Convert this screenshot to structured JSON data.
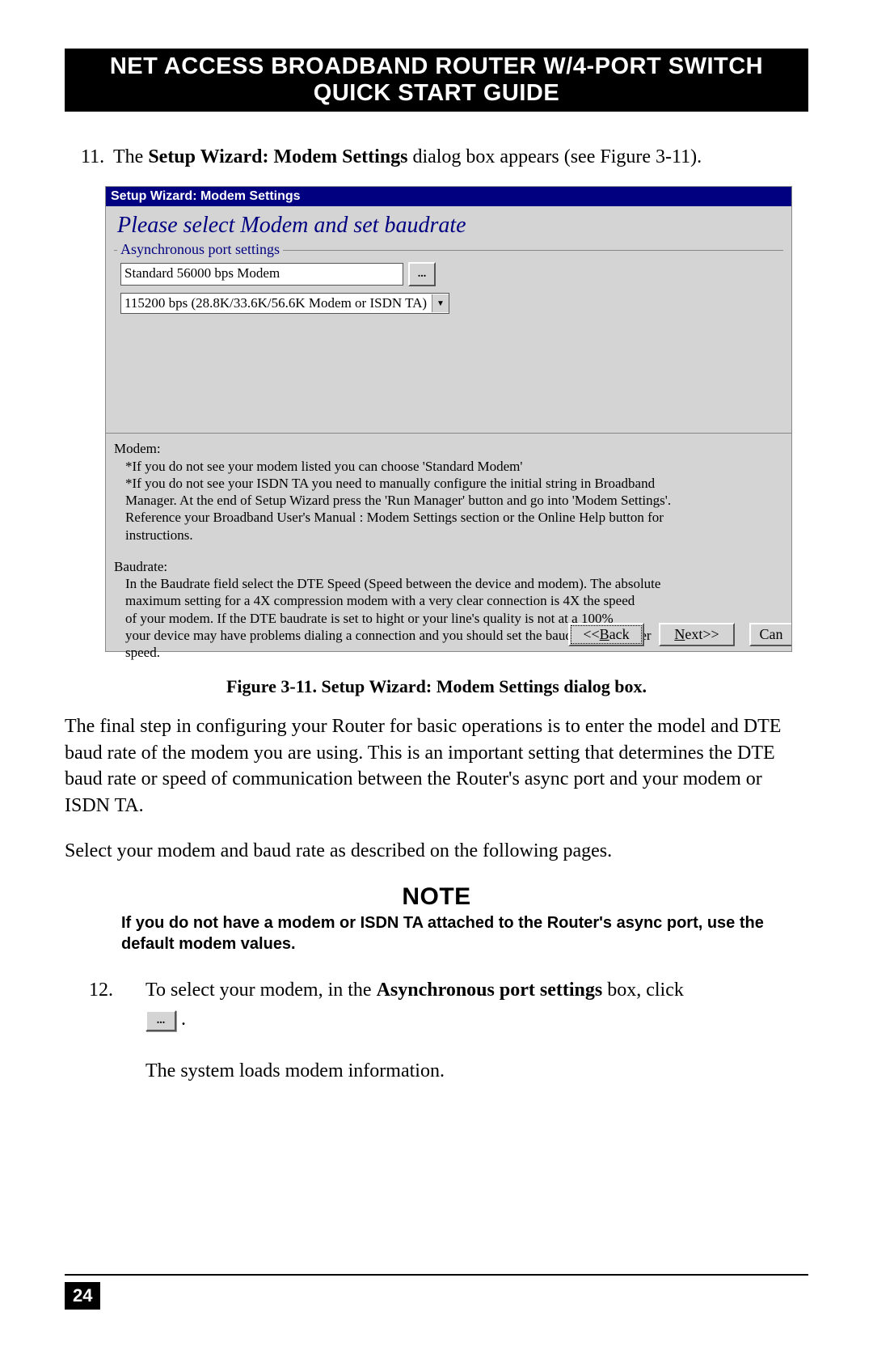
{
  "banner": "NET ACCESS BROADBAND ROUTER W/4-PORT SWITCH QUICK START GUIDE",
  "step11": {
    "num": "11.",
    "pre": "The ",
    "bold": "Setup Wizard: Modem Settings",
    "post": " dialog box appears (see Figure 3-11)."
  },
  "dialog": {
    "title": "Setup Wizard: Modem Settings",
    "heading": "Please select Modem and set baudrate",
    "fieldset_legend": "Asynchronous port settings",
    "modem_input": "Standard 56000 bps Modem",
    "ellipsis": "...",
    "baud_select": "115200 bps (28.8K/33.6K/56.6K Modem or ISDN TA)",
    "info": {
      "modem_label": "Modem:",
      "modem_line1": "*If you do not see your modem listed you can choose 'Standard Modem'",
      "modem_line2": "*If you do not see your ISDN TA you need to manually configure the initial string in Broadband",
      "modem_line3": "Manager.  At the end of Setup Wizard press the 'Run Manager' button and go into 'Modem Settings'.",
      "modem_line4": "Reference your Broadband User's Manual : Modem Settings section or the Online Help button for",
      "modem_line5": "instructions.",
      "baud_label": "Baudrate:",
      "baud_line1": "In the Baudrate field select the DTE Speed (Speed between the device and modem).  The absolute",
      "baud_line2": "maximum setting for a 4X compression modem with a very clear connection is 4X the speed",
      "baud_line3": "of your modem. If the DTE baudrate is set to hight or your line's quality is not at a 100%",
      "baud_line4": "your device may have problems dialing a connection and you should set the baudrate to a lower",
      "baud_line5": "speed."
    },
    "buttons": {
      "back": "<<Back",
      "next": "Next>>",
      "cancel": "Can"
    }
  },
  "caption": "Figure 3-11. Setup Wizard: Modem Settings dialog box.",
  "para1": "The final step in configuring your Router for basic operations is to enter the model and DTE baud rate of the modem you are using. This is an important setting that determines the DTE baud rate or speed of communication between the Router's async port and your modem or ISDN TA.",
  "para2": "Select your modem and baud rate as described on the following pages.",
  "note_head": "NOTE",
  "note_body": "If you do not have a modem or ISDN TA attached to the Router's async port, use the default modem values.",
  "step12": {
    "num": "12.",
    "t1": "To select your modem, in the ",
    "bold": "Asynchronous port settings",
    "t2": " box, click",
    "ellipsis": "...",
    "period": " ."
  },
  "post12": "The system loads modem information.",
  "page_number": "24"
}
